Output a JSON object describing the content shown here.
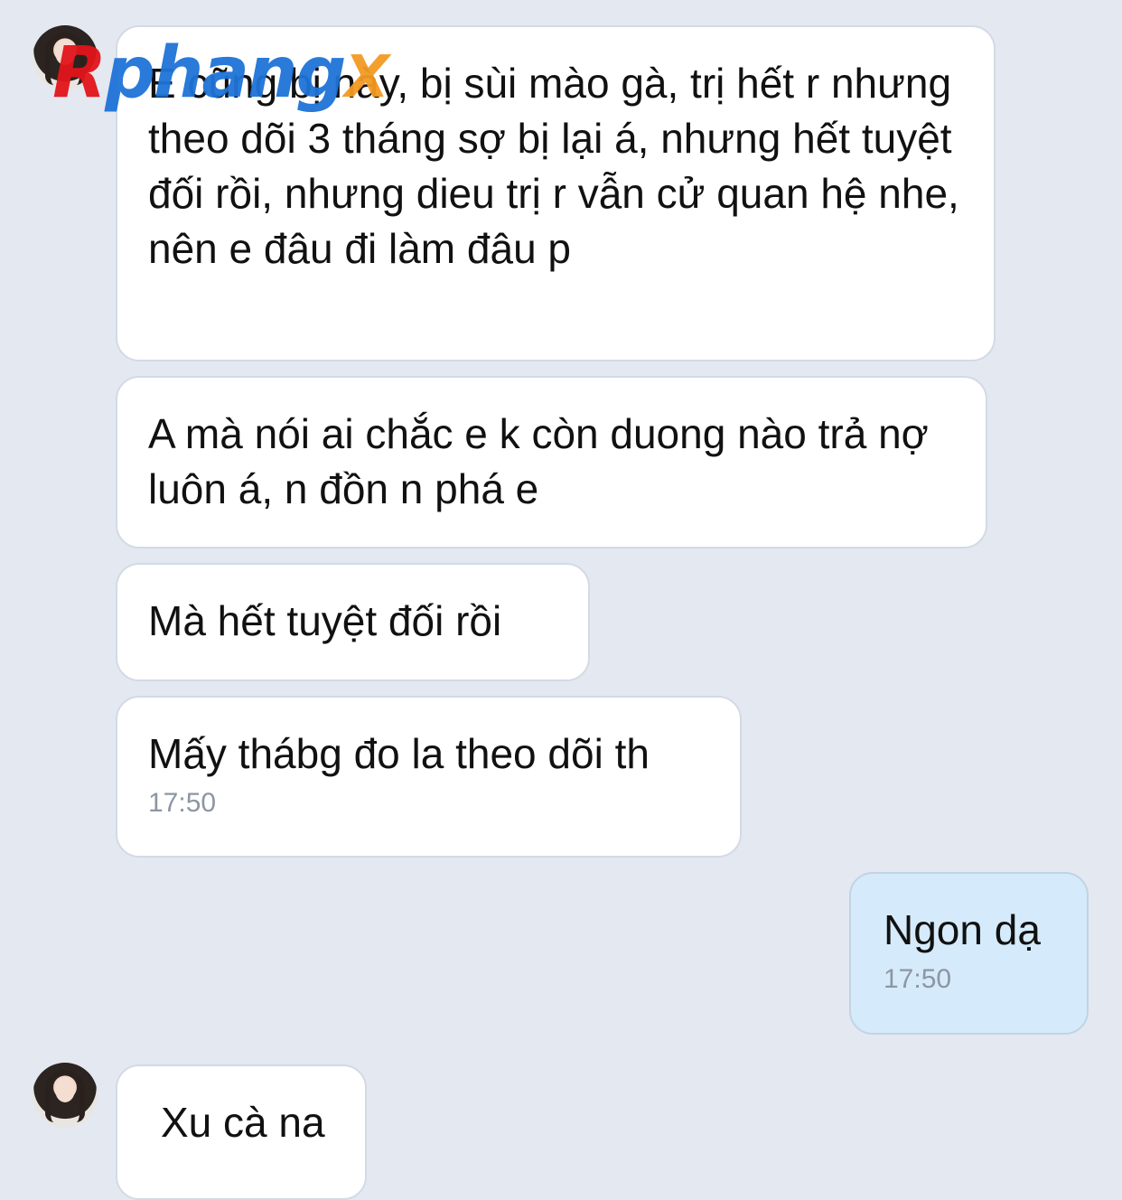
{
  "watermark": {
    "r": "R",
    "text": "phang",
    "x": "X"
  },
  "messages": [
    {
      "text": "E cũng bị này, bị sùi mào gà, trị hết r nhưng theo dõi 3 tháng sợ bị lại á, nhưng hết tuyệt đối rồi, nhưng dieu trị r vẫn cử quan hệ nhe, nên e đâu đi làm đâu p"
    },
    {
      "text": "A mà nói ai chắc e k còn duong nào trả nợ luôn á, n đồn n phá e"
    },
    {
      "text": "Mà hết tuyệt đối rồi"
    },
    {
      "text": "Mấy thábg đo la theo dõi th",
      "time": "17:50"
    },
    {
      "text": "Ngon dạ",
      "time": "17:50"
    },
    {
      "text": "Xu cà na"
    }
  ]
}
